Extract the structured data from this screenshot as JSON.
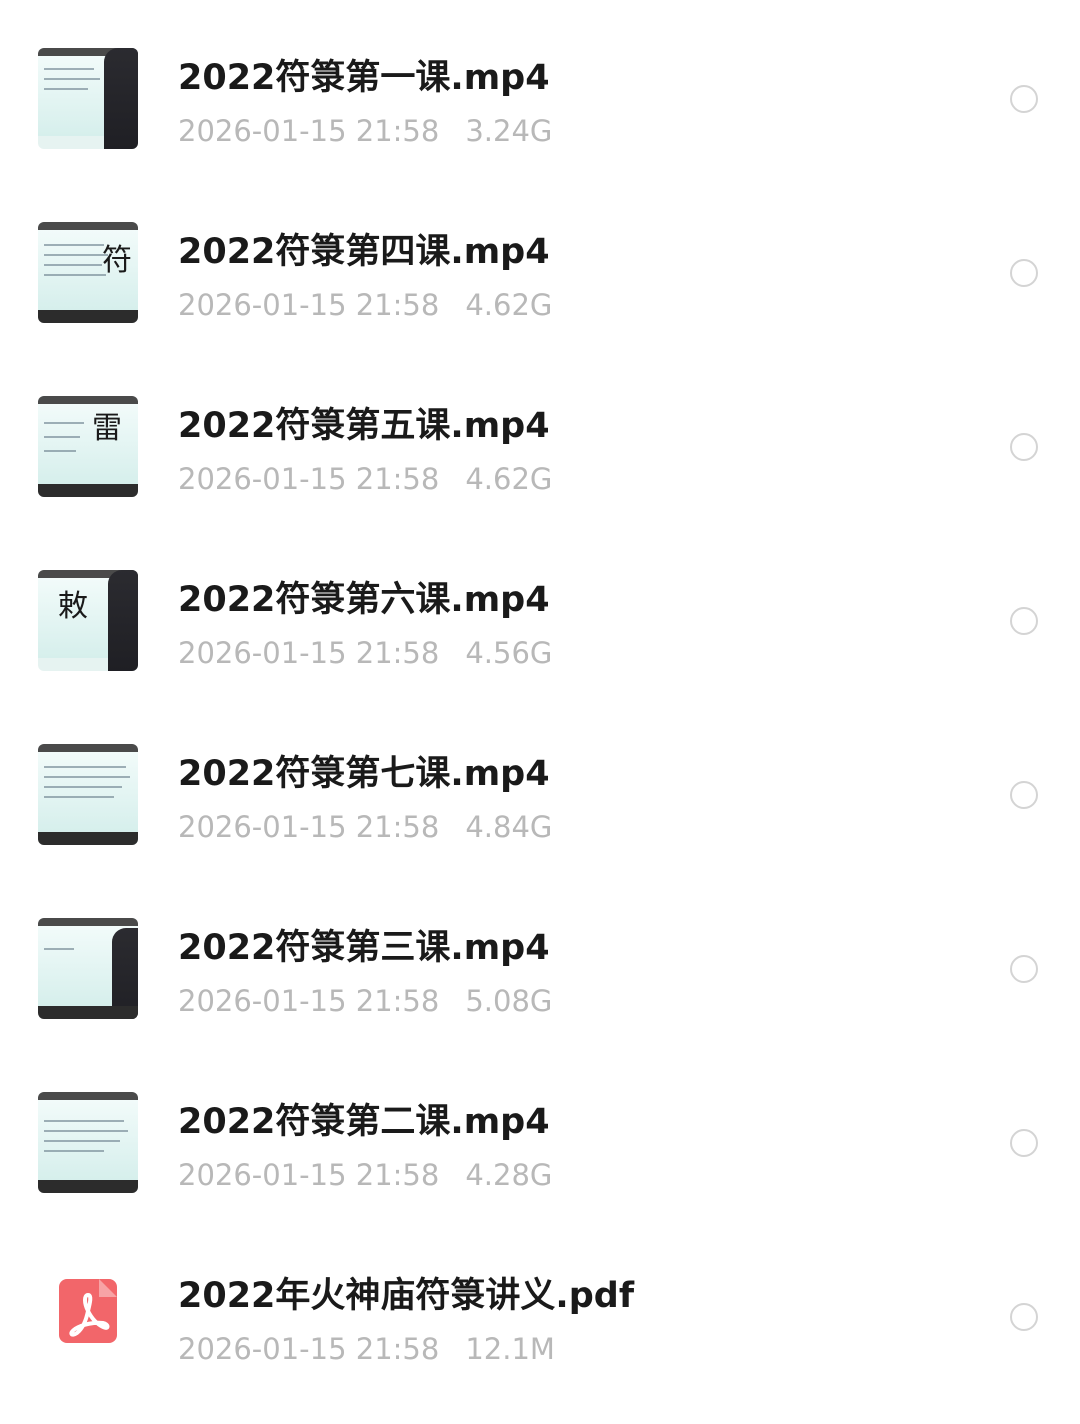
{
  "files": [
    {
      "name": "2022符箓第一课.mp4",
      "date": "2026-01-15 21:58",
      "size": "3.24G",
      "type": "video",
      "thumb_icon": "lecture-video-thumbnail"
    },
    {
      "name": "2022符箓第四课.mp4",
      "date": "2026-01-15 21:58",
      "size": "4.62G",
      "type": "video",
      "thumb_icon": "lecture-video-thumbnail"
    },
    {
      "name": "2022符箓第五课.mp4",
      "date": "2026-01-15 21:58",
      "size": "4.62G",
      "type": "video",
      "thumb_icon": "lecture-video-thumbnail"
    },
    {
      "name": "2022符箓第六课.mp4",
      "date": "2026-01-15 21:58",
      "size": "4.56G",
      "type": "video",
      "thumb_icon": "lecture-video-thumbnail"
    },
    {
      "name": "2022符箓第七课.mp4",
      "date": "2026-01-15 21:58",
      "size": "4.84G",
      "type": "video",
      "thumb_icon": "lecture-video-thumbnail"
    },
    {
      "name": "2022符箓第三课.mp4",
      "date": "2026-01-15 21:58",
      "size": "5.08G",
      "type": "video",
      "thumb_icon": "lecture-video-thumbnail"
    },
    {
      "name": "2022符箓第二课.mp4",
      "date": "2026-01-15 21:58",
      "size": "4.28G",
      "type": "video",
      "thumb_icon": "lecture-video-thumbnail"
    },
    {
      "name": "2022年火神庙符箓讲义.pdf",
      "date": "2026-01-15 21:58",
      "size": "12.1M",
      "type": "pdf",
      "thumb_icon": "pdf-icon"
    }
  ],
  "colors": {
    "name_text": "#1a1a1a",
    "meta_text": "#b8b8b8",
    "radio_border": "#d4d4d4",
    "pdf_icon": "#f2666a"
  }
}
